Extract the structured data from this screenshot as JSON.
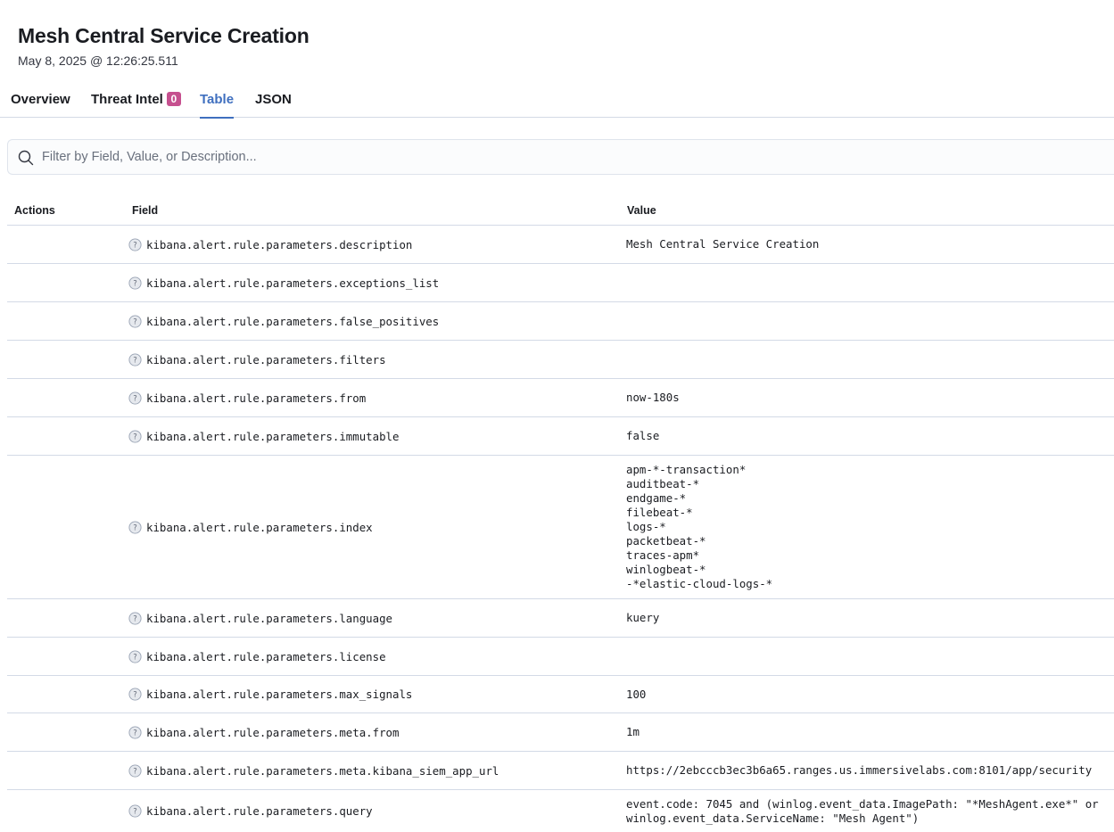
{
  "header": {
    "title": "Mesh Central Service Creation",
    "timestamp": "May 8, 2025 @ 12:26:25.511"
  },
  "tabs": [
    {
      "label": "Overview",
      "active": false
    },
    {
      "label": "Threat Intel",
      "badge": "0",
      "active": false
    },
    {
      "label": "Table",
      "active": true
    },
    {
      "label": "JSON",
      "active": false
    }
  ],
  "search": {
    "placeholder": "Filter by Field, Value, or Description...",
    "value": "",
    "icon": "search-icon"
  },
  "table": {
    "columns": [
      "Actions",
      "Field",
      "Value"
    ],
    "rows": [
      {
        "field": "kibana.alert.rule.parameters.description",
        "value": "Mesh Central Service Creation"
      },
      {
        "field": "kibana.alert.rule.parameters.exceptions_list",
        "value": ""
      },
      {
        "field": "kibana.alert.rule.parameters.false_positives",
        "value": ""
      },
      {
        "field": "kibana.alert.rule.parameters.filters",
        "value": ""
      },
      {
        "field": "kibana.alert.rule.parameters.from",
        "value": "now-180s"
      },
      {
        "field": "kibana.alert.rule.parameters.immutable",
        "value": "false"
      },
      {
        "field": "kibana.alert.rule.parameters.index",
        "values": [
          "apm-*-transaction*",
          "auditbeat-*",
          "endgame-*",
          "filebeat-*",
          "logs-*",
          "packetbeat-*",
          "traces-apm*",
          "winlogbeat-*",
          "-*elastic-cloud-logs-*"
        ]
      },
      {
        "field": "kibana.alert.rule.parameters.language",
        "value": "kuery"
      },
      {
        "field": "kibana.alert.rule.parameters.license",
        "value": ""
      },
      {
        "field": "kibana.alert.rule.parameters.max_signals",
        "value": "100"
      },
      {
        "field": "kibana.alert.rule.parameters.meta.from",
        "value": "1m"
      },
      {
        "field": "kibana.alert.rule.parameters.meta.kibana_siem_app_url",
        "value": "https://2ebcccb3ec3b6a65.ranges.us.immersivelabs.com:8101/app/security"
      },
      {
        "field": "kibana.alert.rule.parameters.query",
        "values": [
          "event.code: 7045 and (winlog.event_data.ImagePath: \"*MeshAgent.exe*\" or",
          "winlog.event_data.ServiceName: \"Mesh Agent\")"
        ]
      }
    ]
  },
  "colors": {
    "accent": "#3f6fbf",
    "badge": "#c6508f",
    "border": "#d3dae6"
  }
}
